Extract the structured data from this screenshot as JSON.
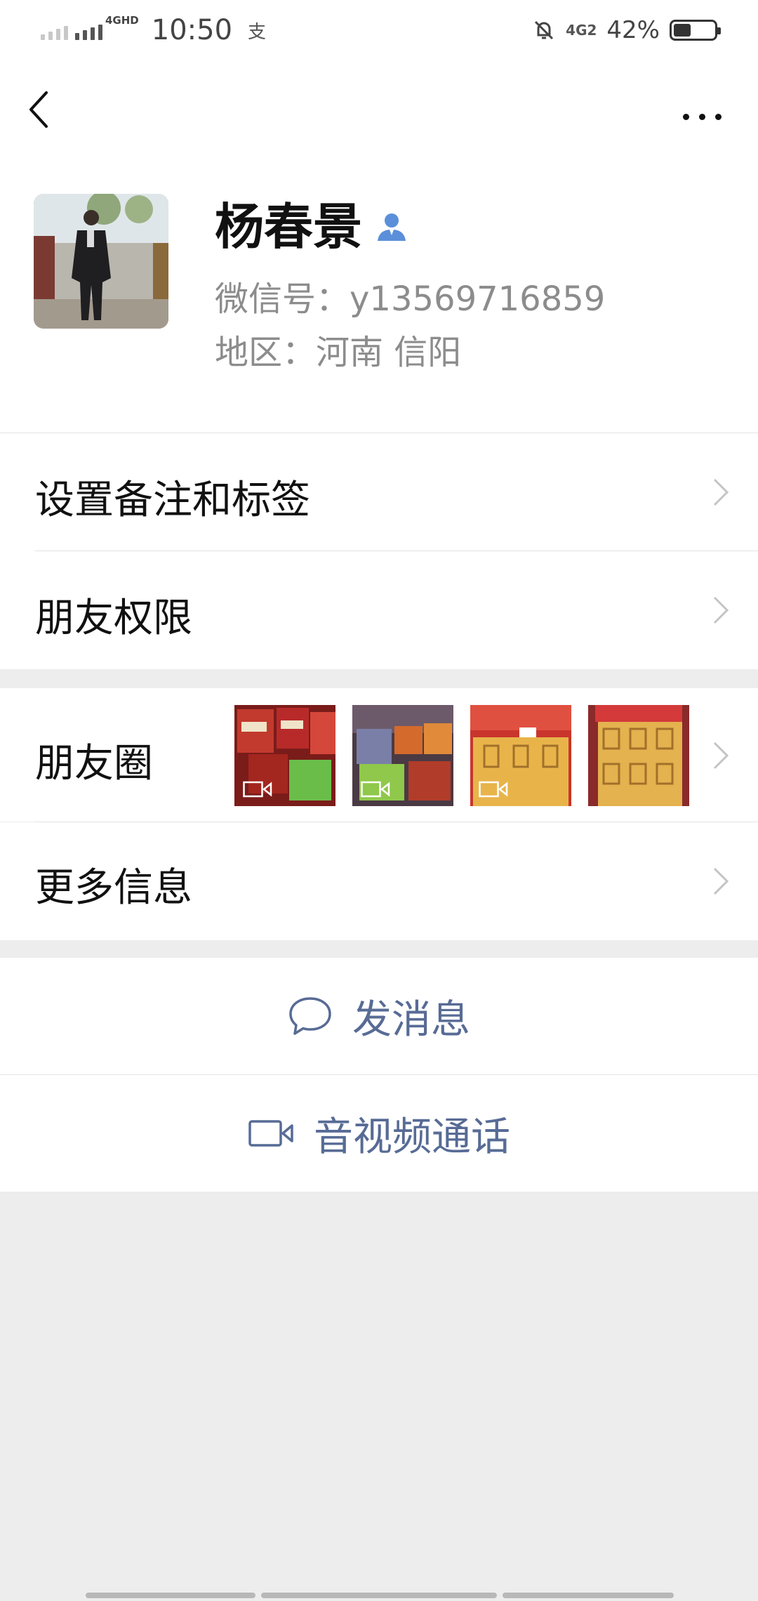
{
  "status_bar": {
    "network": "4GHD",
    "time": "10:50",
    "app_glyph": "支",
    "right_network": "4G2",
    "battery_percent": "42%",
    "battery_level": 0.42
  },
  "profile": {
    "name": "杨春景",
    "wechat_id": "微信号：y13569716859",
    "region": "地区：河南  信阳"
  },
  "menu": {
    "remark_tags": "设置备注和标签",
    "friend_permissions": "朋友权限",
    "moments": "朋友圈",
    "more_info": "更多信息"
  },
  "actions": {
    "send_message": "发消息",
    "video_call": "音视频通话"
  },
  "icons": {
    "back": "back-arrow-icon",
    "more": "more-dots-icon",
    "contact": "person-icon",
    "message": "chat-bubble-icon",
    "video": "video-camera-icon"
  },
  "colors": {
    "link_blue": "#576b95",
    "contact_icon_blue": "#5b8fd9",
    "background": "#ededed"
  }
}
